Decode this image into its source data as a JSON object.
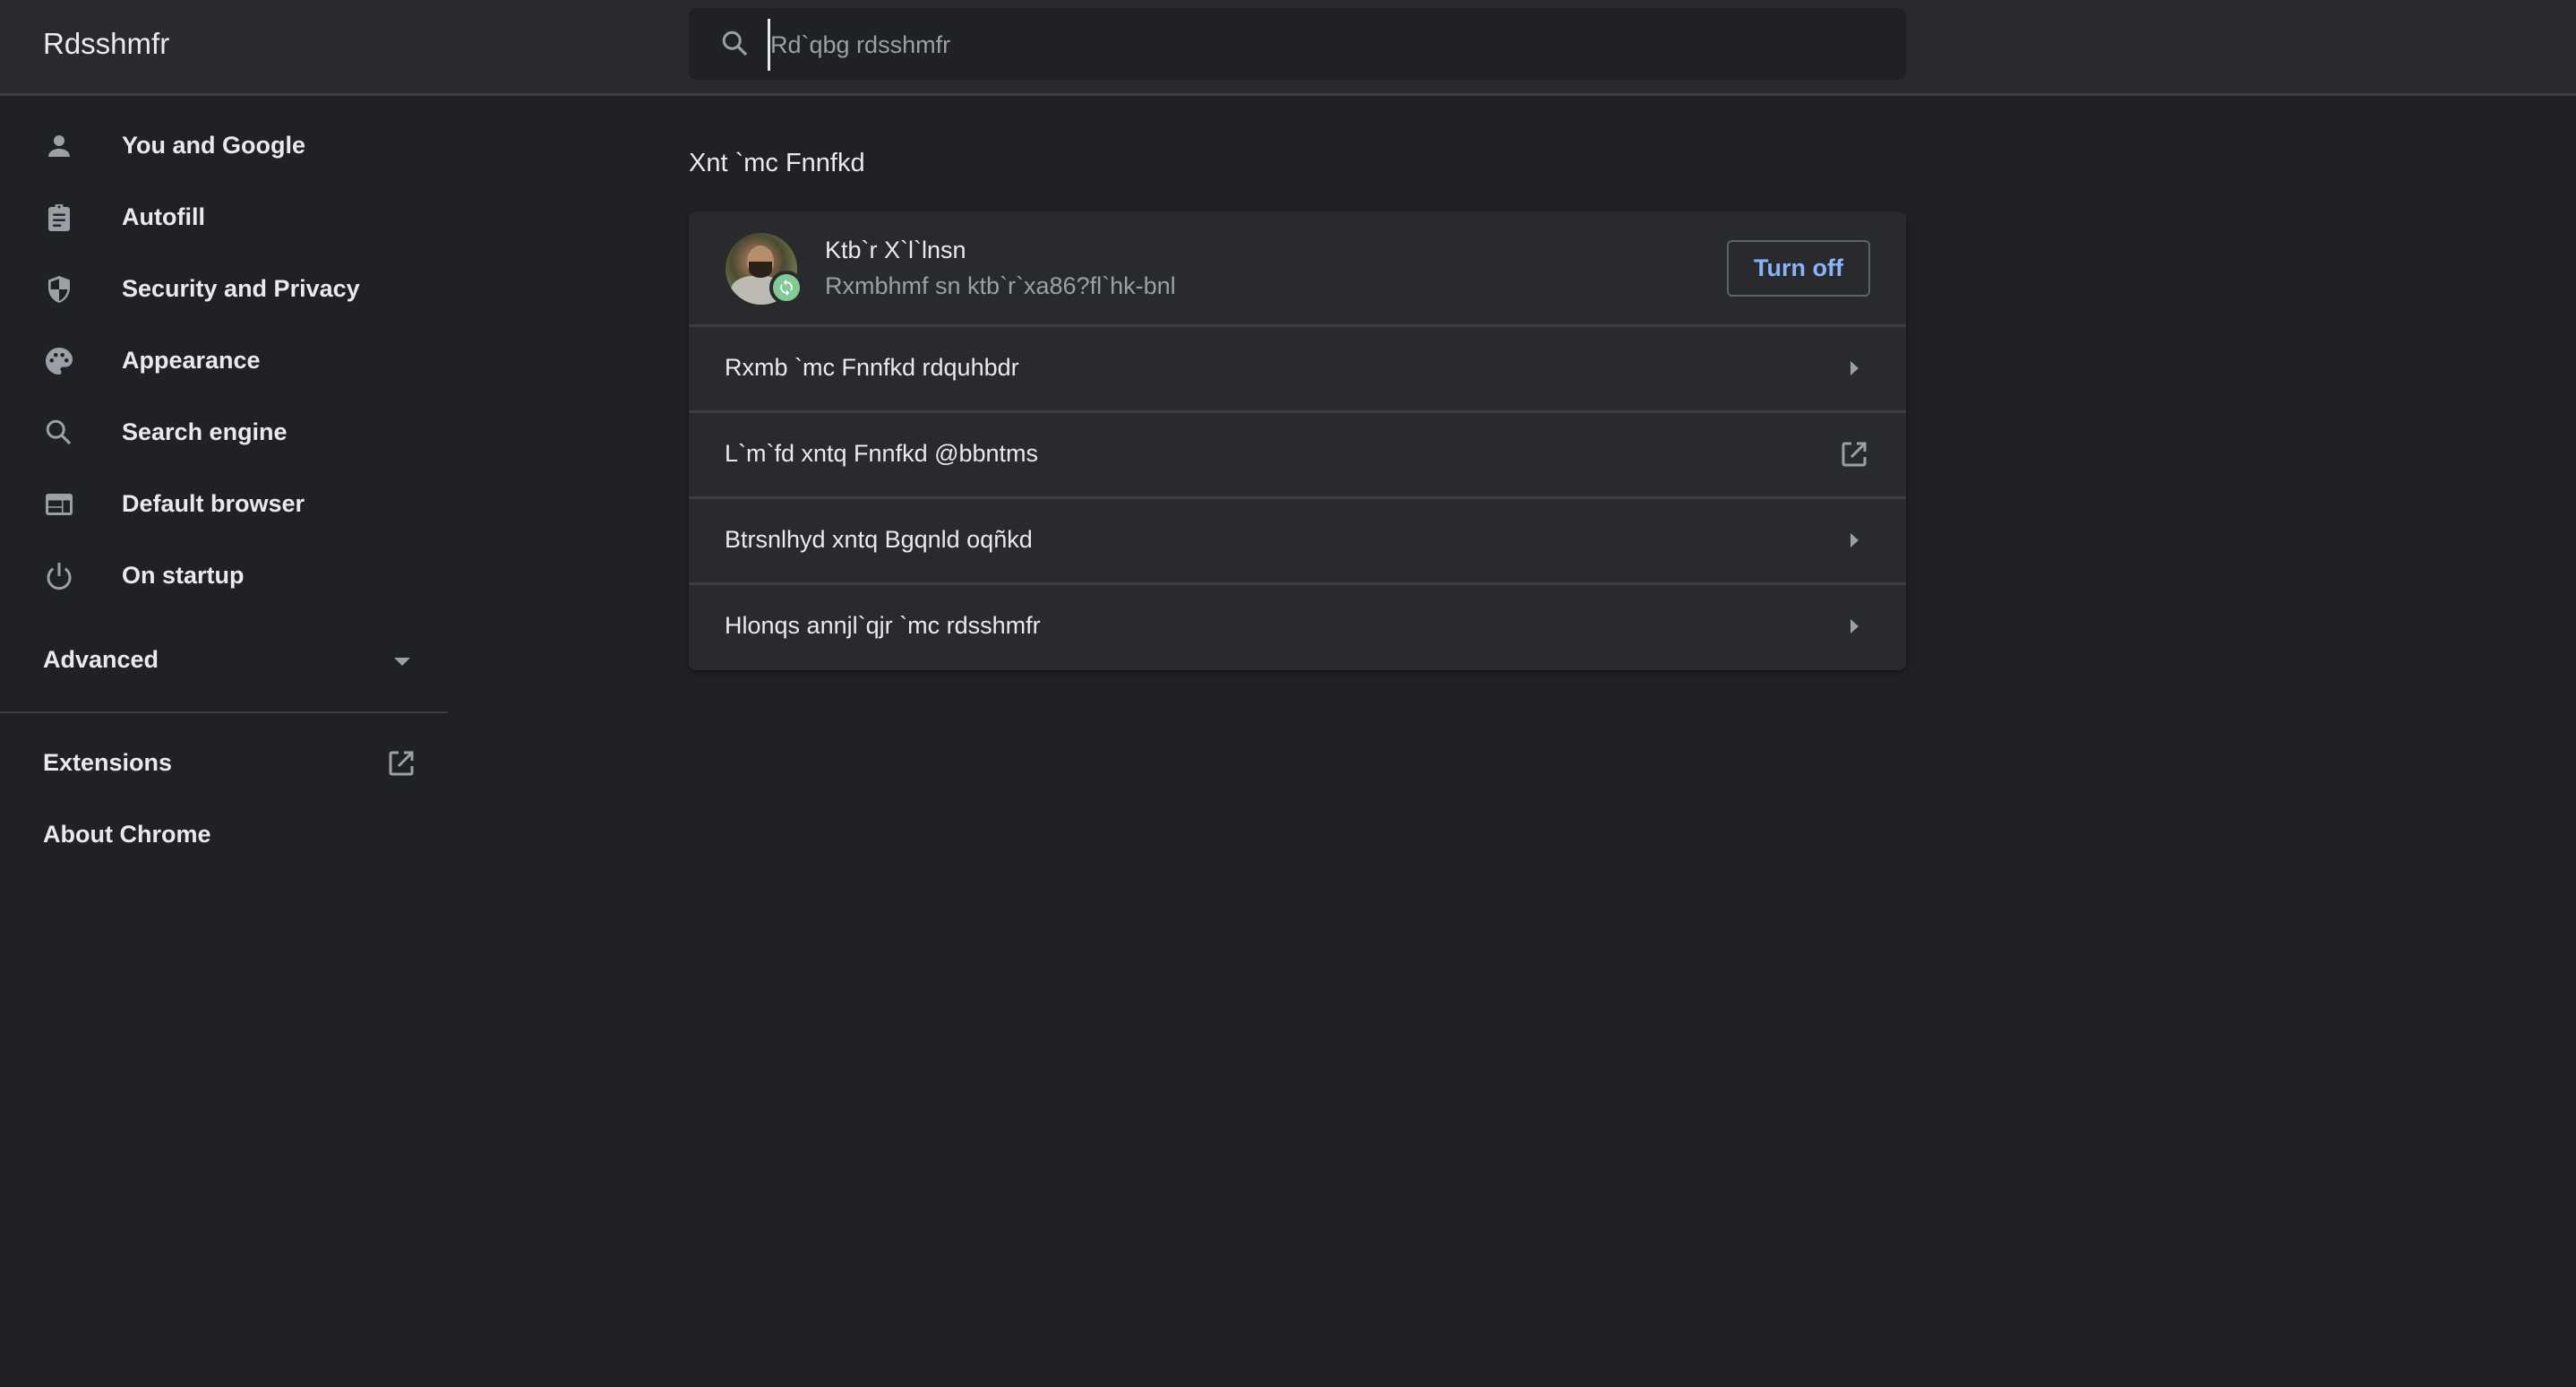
{
  "header": {
    "title": "Rdsshmfr",
    "search": {
      "placeholder": "Rd`qbg rdsshmfr",
      "value": ""
    }
  },
  "sidebar": {
    "items": [
      {
        "label": "You and Google",
        "icon": "person-icon"
      },
      {
        "label": "Autofill",
        "icon": "clipboard-icon"
      },
      {
        "label": "Security and Privacy",
        "icon": "shield-icon"
      },
      {
        "label": "Appearance",
        "icon": "palette-icon"
      },
      {
        "label": "Search engine",
        "icon": "search-icon"
      },
      {
        "label": "Default browser",
        "icon": "browser-window-icon"
      },
      {
        "label": "On startup",
        "icon": "power-icon"
      }
    ],
    "advanced_label": "Advanced",
    "extensions_label": "Extensions",
    "about_label": "About Chrome"
  },
  "main": {
    "section_title": "Xnt `mc Fnnfkd",
    "profile": {
      "name": "Ktb`r X`l`lnsn",
      "status": "Rxmbhmf sn ktb`r`xa86?fl`hk-bnl",
      "turn_off_label": "Turn off",
      "badge": "sync-icon"
    },
    "rows": [
      {
        "label": "Rxmb `mc Fnnfkd rdquhbdr",
        "action": "arrow-right-icon"
      },
      {
        "label": "L`m`fd xntq Fnnfkd @bbntms",
        "action": "external-link-icon"
      },
      {
        "label": "Btrsnlhyd xntq Bgqnld oqñkd",
        "action": "arrow-right-icon"
      },
      {
        "label": "Hlonqs annjl`qjr `mc rdsshmfr",
        "action": "arrow-right-icon"
      }
    ]
  },
  "colors": {
    "background": "#202124",
    "header": "#292a2d",
    "card": "#292a2d",
    "accent": "#8ab4f8",
    "sync_badge": "#81c995",
    "secondary_text": "#9aa0a6"
  }
}
